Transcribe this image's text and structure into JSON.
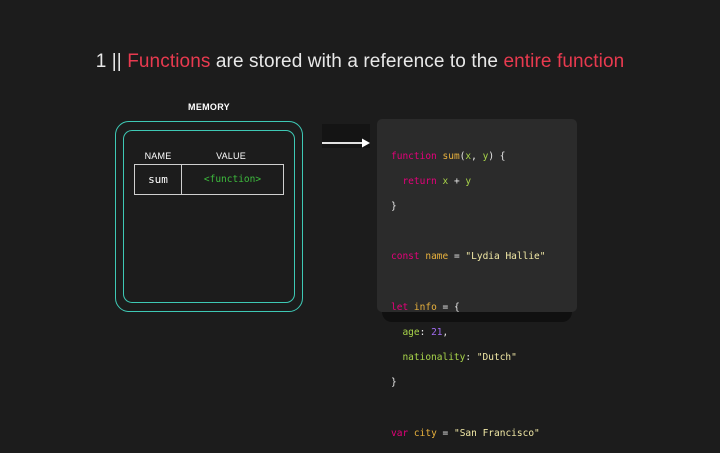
{
  "title": {
    "prefix": "1 || ",
    "highlight1": "Functions",
    "middle": " are stored with a reference to the ",
    "highlight2": "entire function"
  },
  "memory": {
    "label": "MEMORY",
    "col_name": "NAME",
    "col_value": "VALUE",
    "rows": [
      {
        "name": "sum",
        "value": "<function>"
      }
    ]
  },
  "code": {
    "l1_kw": "function",
    "l1_fn": "sum",
    "l1_open": "(",
    "l1_x": "x",
    "l1_comma": ", ",
    "l1_y": "y",
    "l1_close": ") {",
    "l2_kw": "return",
    "l2_x": "x",
    "l2_plus": " + ",
    "l2_y": "y",
    "l3": "}",
    "l5_kw": "const",
    "l5_id": "name",
    "l5_eq": " = ",
    "l5_str": "\"Lydia Hallie\"",
    "l7_kw": "let",
    "l7_id": "info",
    "l7_rest": " = {",
    "l8_prop": "age",
    "l8_colon": ": ",
    "l8_num": "21",
    "l8_comma": ",",
    "l9_prop": "nationality",
    "l9_colon": ": ",
    "l9_str": "\"Dutch\"",
    "l10": "}",
    "l12_kw": "var",
    "l12_id": "city",
    "l12_eq": " = ",
    "l12_str": "\"San Francisco\""
  },
  "colors": {
    "highlight": "#e83a4f",
    "memory_border": "#3ec9b5",
    "function_value": "#3dbb3d",
    "keyword": "#e5007a"
  }
}
